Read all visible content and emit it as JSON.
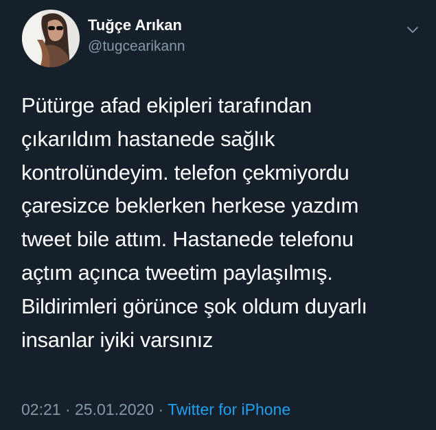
{
  "author": {
    "name": "Tuğçe Arıkan",
    "handle": "@tugcearikann",
    "avatar_icon": "profile-photo-icon"
  },
  "tweet": {
    "lines": [
      "Pütürge afad ekipleri tarafından",
      "çıkarıldım hastanede sağlık",
      "kontrolündeyim. telefon çekmiyordu",
      "çaresizce beklerken herkese yazdım",
      "tweet bile attım. Hastanede telefonu",
      "açtım açınca tweetim paylaşılmış.",
      "Bildirimleri görünce şok oldum duyarlı",
      "insanlar iyiki varsınız"
    ]
  },
  "meta": {
    "time": "02:21",
    "separator": " · ",
    "date": "25.01.2020",
    "source": "Twitter for iPhone"
  },
  "menu": {
    "icon": "chevron-down-icon"
  },
  "colors": {
    "background": "#15202b",
    "text": "#ffffff",
    "secondary": "#8899a6",
    "link": "#1da1f2"
  }
}
